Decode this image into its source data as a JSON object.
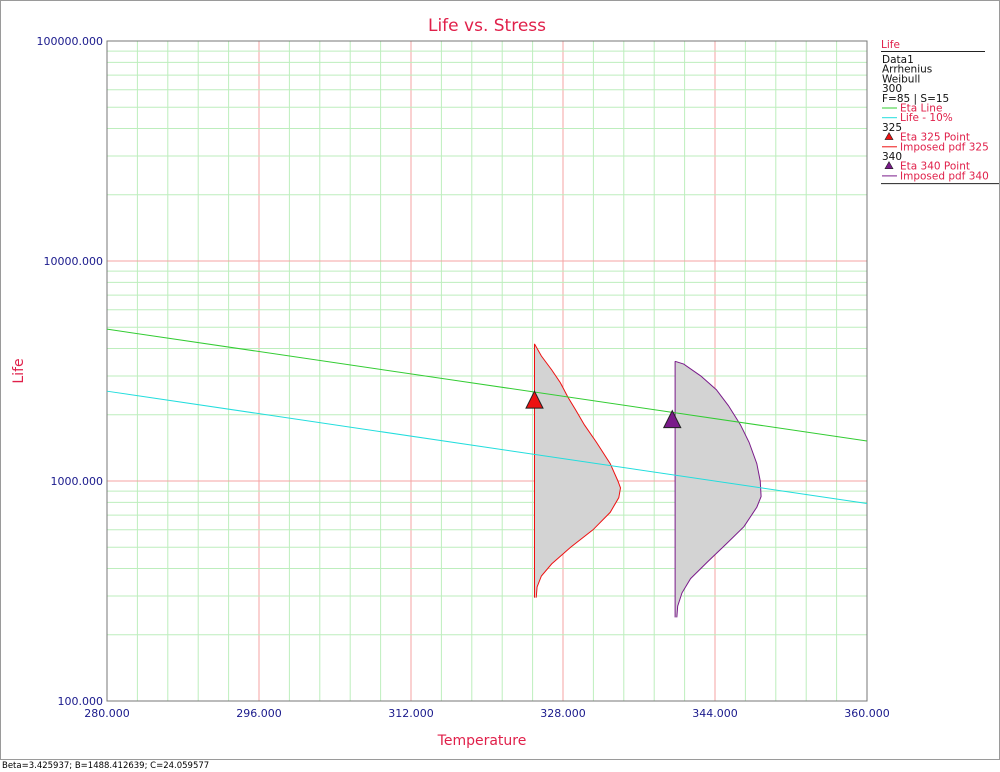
{
  "chart_data": {
    "type": "line",
    "title": "Life vs. Stress",
    "xlabel": "Temperature",
    "ylabel": "Life",
    "xlim": [
      280,
      360
    ],
    "ylim": [
      100,
      100000
    ],
    "yscale": "log",
    "grid": true,
    "x_ticks": [
      "280.000",
      "296.000",
      "312.000",
      "328.000",
      "344.000",
      "360.000"
    ],
    "y_ticks": [
      "100.000",
      "1000.000",
      "10000.000",
      "100000.000"
    ],
    "series": [
      {
        "name": "Eta Line",
        "color": "#33cc33",
        "x": [
          280,
          360
        ],
        "y": [
          4900,
          1520
        ]
      },
      {
        "name": "Life - 10%",
        "color": "#22dddd",
        "x": [
          280,
          360
        ],
        "y": [
          2560,
          790
        ]
      }
    ],
    "points": [
      {
        "name": "Eta 325 Point",
        "color": "#ee1111",
        "x": 325,
        "y": 2330
      },
      {
        "name": "Eta 340 Point",
        "color": "#7a1a8a",
        "x": 339.5,
        "y": 1900
      }
    ],
    "pdfs": [
      {
        "name": "Imposed pdf 325",
        "color": "#ee1111",
        "x_base": 325,
        "peak_x": 331.2,
        "profile": [
          [
            295,
            0.02
          ],
          [
            330,
            0.03
          ],
          [
            370,
            0.08
          ],
          [
            420,
            0.2
          ],
          [
            500,
            0.42
          ],
          [
            600,
            0.68
          ],
          [
            720,
            0.88
          ],
          [
            840,
            0.98
          ],
          [
            930,
            1.0
          ],
          [
            1000,
            0.97
          ],
          [
            1200,
            0.88
          ],
          [
            1500,
            0.72
          ],
          [
            1800,
            0.58
          ],
          [
            2100,
            0.48
          ],
          [
            2400,
            0.39
          ],
          [
            2800,
            0.3
          ],
          [
            3200,
            0.2
          ],
          [
            3700,
            0.08
          ],
          [
            4200,
            0.0
          ]
        ]
      },
      {
        "name": "Imposed pdf 340",
        "color": "#7a1a8a",
        "x_base": 339.8,
        "peak_x": 350.9,
        "profile": [
          [
            240,
            0.02
          ],
          [
            270,
            0.03
          ],
          [
            310,
            0.08
          ],
          [
            360,
            0.18
          ],
          [
            430,
            0.38
          ],
          [
            520,
            0.6
          ],
          [
            620,
            0.8
          ],
          [
            760,
            0.95
          ],
          [
            850,
            1.0
          ],
          [
            1000,
            0.99
          ],
          [
            1200,
            0.95
          ],
          [
            1500,
            0.86
          ],
          [
            1800,
            0.76
          ],
          [
            2200,
            0.62
          ],
          [
            2600,
            0.48
          ],
          [
            3000,
            0.3
          ],
          [
            3400,
            0.1
          ],
          [
            3500,
            0.0
          ]
        ]
      }
    ],
    "legend": {
      "title": "Life",
      "entries": [
        {
          "text": "Data1",
          "kind": "text"
        },
        {
          "text": "Arrhenius",
          "kind": "text"
        },
        {
          "text": "Weibull",
          "kind": "text"
        },
        {
          "text": "300",
          "kind": "text"
        },
        {
          "text": "F=85 | S=15",
          "kind": "text"
        },
        {
          "text": "Eta Line",
          "kind": "line",
          "color": "#33cc33"
        },
        {
          "text": "Life - 10%",
          "kind": "line",
          "color": "#22dddd"
        },
        {
          "text": "325",
          "kind": "text"
        },
        {
          "text": "Eta 325 Point",
          "kind": "marker",
          "color": "#ee1111"
        },
        {
          "text": "Imposed pdf 325",
          "kind": "line",
          "color": "#ee1111"
        },
        {
          "text": "340",
          "kind": "text"
        },
        {
          "text": "Eta 340 Point",
          "kind": "marker",
          "color": "#7a1a8a"
        },
        {
          "text": "Imposed pdf 340",
          "kind": "line",
          "color": "#7a1a8a"
        }
      ]
    }
  },
  "status": "Beta=3.425937; B=1488.412639; C=24.059577"
}
